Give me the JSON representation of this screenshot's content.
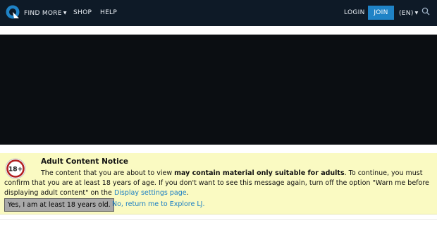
{
  "header": {
    "nav": [
      {
        "label": "FIND MORE",
        "has_dropdown": true
      },
      {
        "label": "SHOP"
      },
      {
        "label": "HELP"
      }
    ],
    "login_label": "LOGIN",
    "join_label": "JOIN",
    "language_label": "(EN)",
    "colors": {
      "bar": "#0e1a27",
      "join": "#1f83c6"
    }
  },
  "notice": {
    "badge_text": "18+",
    "title": "Adult Content Notice",
    "text_1": "The content that you are about to view ",
    "text_bold": "may contain material only suitable for adults",
    "text_2": ". To continue, you must confirm that you are at least 18 years of age. If you don't want to see this message again, turn off the option \"Warn me before displaying adult content\" on the ",
    "settings_link": "Display settings page",
    "text_3": ".",
    "confirm_button": "Yes, I am at least 18 years old.",
    "decline_link": "No, return me to Explore LJ."
  }
}
